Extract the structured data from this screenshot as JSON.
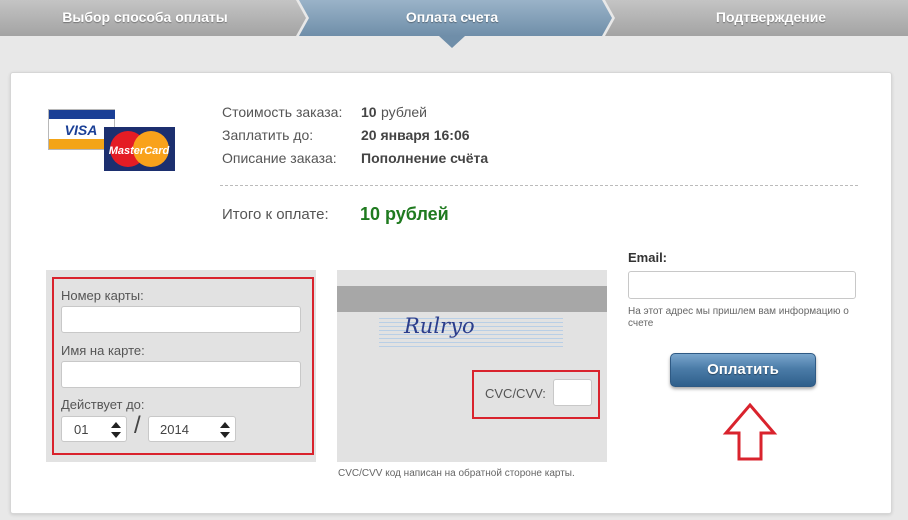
{
  "steps": [
    {
      "label": "Выбор способа оплаты",
      "state": "done"
    },
    {
      "label": "Оплата счета",
      "state": "active"
    },
    {
      "label": "Подтверждение",
      "state": "pending"
    }
  ],
  "logos": {
    "visa": "VISA",
    "mastercard": "MasterCard"
  },
  "order": {
    "cost_label": "Стоимость заказа:",
    "cost_value": "10",
    "cost_unit": "рублей",
    "due_label": "Заплатить до:",
    "due_value": "20 января 16:06",
    "desc_label": "Описание заказа:",
    "desc_value": "Пополнение счёта",
    "total_label": "Итого к оплате:",
    "total_value": "10 рублей"
  },
  "card_front": {
    "number_label": "Номер карты:",
    "number_value": "",
    "name_label": "Имя на карте:",
    "name_value": "",
    "expiry_label": "Действует до:",
    "month_value": "01",
    "year_value": "2014",
    "separator": "/"
  },
  "card_back": {
    "cvc_label": "CVC/CVV:",
    "cvc_value": "",
    "signature": "Rulryo",
    "hint": "CVC/CVV код написан на обратной стороне карты."
  },
  "email": {
    "label": "Email:",
    "value": "",
    "hint": "На этот адрес мы пришлем вам информацию о счете"
  },
  "pay_button": "Оплатить",
  "colors": {
    "step_active": "#7d9bb5",
    "step_inactive": "#b0b0b0",
    "highlight_red": "#d9232d",
    "total_green": "#1f7a1f",
    "button_blue": "#4b7ca8"
  }
}
